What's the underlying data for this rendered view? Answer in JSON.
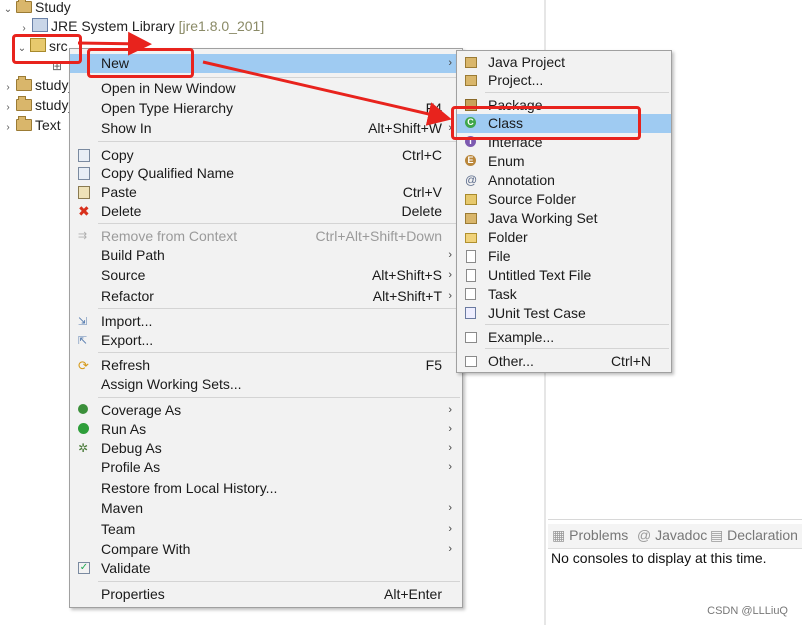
{
  "tree": {
    "root": "Study",
    "jre": "JRE System Library",
    "jre_version": "[jre1.8.0_201]",
    "src": "src",
    "sibling1": "study_",
    "sibling2": "study_",
    "text_proj": "Text"
  },
  "context_menu": {
    "new": "New",
    "open_new_window": "Open in New Window",
    "open_type_hierarchy": "Open Type Hierarchy",
    "open_type_hierarchy_shortcut": "F4",
    "show_in": "Show In",
    "show_in_shortcut": "Alt+Shift+W",
    "copy": "Copy",
    "copy_shortcut": "Ctrl+C",
    "copy_qualified": "Copy Qualified Name",
    "paste": "Paste",
    "paste_shortcut": "Ctrl+V",
    "delete": "Delete",
    "delete_shortcut": "Delete",
    "remove_context": "Remove from Context",
    "remove_context_shortcut": "Ctrl+Alt+Shift+Down",
    "build_path": "Build Path",
    "source": "Source",
    "source_shortcut": "Alt+Shift+S",
    "refactor": "Refactor",
    "refactor_shortcut": "Alt+Shift+T",
    "import": "Import...",
    "export": "Export...",
    "refresh": "Refresh",
    "refresh_shortcut": "F5",
    "assign_working_sets": "Assign Working Sets...",
    "coverage_as": "Coverage As",
    "run_as": "Run As",
    "debug_as": "Debug As",
    "profile_as": "Profile As",
    "restore_history": "Restore from Local History...",
    "maven": "Maven",
    "team": "Team",
    "compare_with": "Compare With",
    "validate": "Validate",
    "properties": "Properties",
    "properties_shortcut": "Alt+Enter"
  },
  "submenu": {
    "java_project": "Java Project",
    "project": "Project...",
    "package": "Package",
    "class": "Class",
    "interface": "Interface",
    "enum": "Enum",
    "annotation": "Annotation",
    "source_folder": "Source Folder",
    "java_working_set": "Java Working Set",
    "folder": "Folder",
    "file": "File",
    "untitled_text_file": "Untitled Text File",
    "task": "Task",
    "junit_test_case": "JUnit Test Case",
    "example": "Example...",
    "other": "Other...",
    "other_shortcut": "Ctrl+N"
  },
  "console": {
    "tab_problems": "Problems",
    "tab_javadoc": "Javadoc",
    "tab_declaration": "Declaration",
    "message": "No consoles to display at this time."
  },
  "watermark": "CSDN @LLLiuQ",
  "colors": {
    "highlight": "#9fcbf2",
    "annotation": "#e8231d"
  }
}
